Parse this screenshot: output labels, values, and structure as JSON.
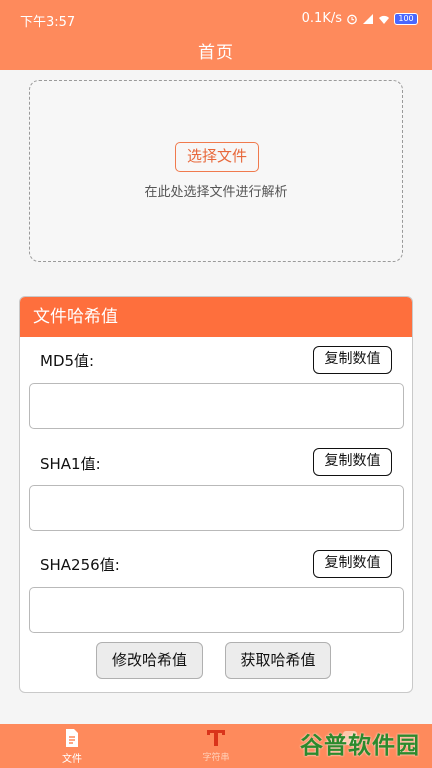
{
  "status_bar": {
    "time": "下午3:57",
    "network_speed": "0.1K/s",
    "battery": "100"
  },
  "nav": {
    "title": "首页"
  },
  "upload": {
    "button_label": "选择文件",
    "hint": "在此处选择文件进行解析"
  },
  "hash_card": {
    "title": "文件哈希值",
    "rows": [
      {
        "label": "MD5值:",
        "copy_label": "复制数值",
        "value": ""
      },
      {
        "label": "SHA1值:",
        "copy_label": "复制数值",
        "value": ""
      },
      {
        "label": "SHA256值:",
        "copy_label": "复制数值",
        "value": ""
      }
    ],
    "modify_label": "修改哈希值",
    "fetch_label": "获取哈希值"
  },
  "tabs": [
    {
      "label": "文件",
      "icon": "file-icon"
    },
    {
      "label": "字符串",
      "icon": "text-icon"
    },
    {
      "label": "",
      "icon": "tab-icon"
    }
  ],
  "watermark": "谷普软件园",
  "colors": {
    "accent": "#fe8a5c",
    "header": "#fe6f3d"
  }
}
